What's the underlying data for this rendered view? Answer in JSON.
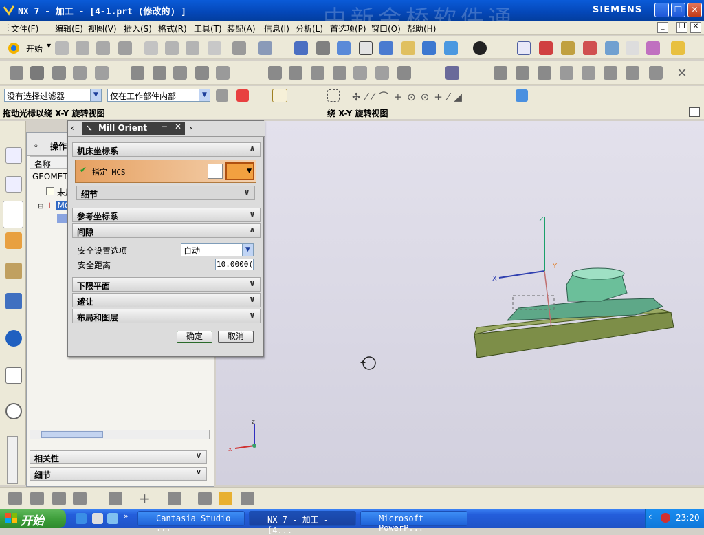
{
  "window": {
    "title": "NX 7 - 加工 - [4-1.prt (修改的) ]",
    "brand": "SIEMENS",
    "watermark": "中新金桥软件通"
  },
  "menu": [
    "文件(F)",
    "编辑(E)",
    "视图(V)",
    "插入(S)",
    "格式(R)",
    "工具(T)",
    "装配(A)",
    "信息(I)",
    "分析(L)",
    "首选项(P)",
    "窗口(O)",
    "帮助(H)"
  ],
  "toolbar": {
    "start_label": "开始"
  },
  "filters": {
    "selection_filter": "没有选择过滤器",
    "scope": "仅在工作部件内部"
  },
  "status": {
    "left": "拖动光标以绕 X-Y 旋转视图",
    "center": "绕 X-Y 旋转视图"
  },
  "navigator": {
    "title": "操作",
    "col_name": "名称",
    "rows": [
      "GEOMETI",
      "未用",
      "MC"
    ],
    "related": "相关性",
    "details": "细节"
  },
  "dialog": {
    "title": "Mill Orient",
    "sec_mcs": "机床坐标系",
    "specify_mcs": "指定 MCS",
    "detail": "细节",
    "sec_ref": "参考坐标系",
    "sec_clearance": "间隙",
    "safe_option_label": "安全设置选项",
    "safe_option_value": "自动",
    "safe_distance_label": "安全距离",
    "safe_distance_value": "10.0000(",
    "sec_lower": "下限平面",
    "sec_avoid": "避让",
    "sec_layout": "布局和图层",
    "ok": "确定",
    "cancel": "取消"
  },
  "viewport": {
    "axis_z": "Z",
    "axis_x": "X",
    "axis_y": "Y",
    "triad_z": "z",
    "triad_x": "x"
  },
  "taskbar": {
    "start": "开始",
    "tasks": [
      "Cantasia Studio ...",
      "NX 7 - 加工 - [4...",
      "Microsoft PowerP..."
    ],
    "clock": "23:20"
  }
}
